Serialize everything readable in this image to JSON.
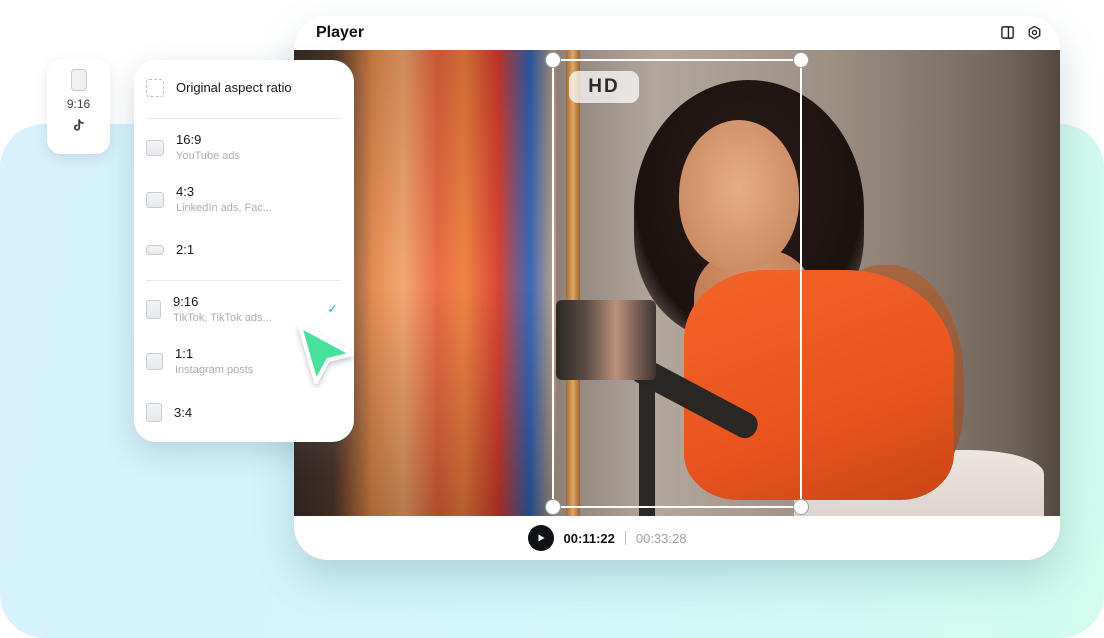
{
  "colors": {
    "accent_check": "#23b7d6",
    "cursor": "#46e19c",
    "play_button": "#0f1115",
    "background_gradient": [
      "#d7f1fd",
      "#d5f5fc",
      "#d3fbee"
    ]
  },
  "ratio_chip": {
    "icon": "portrait-ratio-icon",
    "label": "9:16",
    "platform_icon": "tiktok-icon",
    "platform_glyph": "♪"
  },
  "ratio_menu": {
    "items": [
      {
        "label": "Original aspect ratio",
        "sub": "",
        "icon": "dashed-frame-icon",
        "selected": false
      },
      {
        "label": "16:9",
        "sub": "YouTube ads",
        "icon": "ratio-16-9-icon",
        "selected": false
      },
      {
        "label": "4:3",
        "sub": "LinkedIn ads, Fac...",
        "icon": "ratio-4-3-icon",
        "selected": false
      },
      {
        "label": "2:1",
        "sub": "",
        "icon": "ratio-2-1-icon",
        "selected": false
      },
      {
        "label": "9:16",
        "sub": "TikTok, TikTok ads...",
        "icon": "ratio-9-16-icon",
        "selected": true
      },
      {
        "label": "1:1",
        "sub": "Instagram posts",
        "icon": "ratio-1-1-icon",
        "selected": false
      },
      {
        "label": "3:4",
        "sub": "",
        "icon": "ratio-3-4-icon",
        "selected": false
      }
    ],
    "check_glyph": "✓"
  },
  "player": {
    "title": "Player",
    "header_icons": [
      "split-view-icon",
      "settings-icon"
    ],
    "quality_badge": "HD",
    "crop_ratio": "9:16",
    "time_current": "00:11:22",
    "time_total": "00:33:28"
  }
}
